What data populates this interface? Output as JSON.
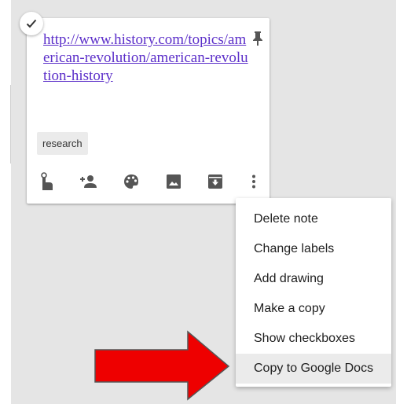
{
  "note": {
    "link_text": "http://www.history.com/topics/american-revolution/american-revolution-history",
    "label": "research",
    "icons": [
      "checkmark-icon",
      "pin-icon",
      "remind-icon",
      "collaborator-icon",
      "palette-icon",
      "image-icon",
      "archive-icon",
      "more-vert-icon"
    ]
  },
  "menu": {
    "items": [
      {
        "label": "Delete note"
      },
      {
        "label": "Change labels"
      },
      {
        "label": "Add drawing"
      },
      {
        "label": "Make a copy"
      },
      {
        "label": "Show checkboxes"
      },
      {
        "label": "Copy to Google Docs"
      }
    ],
    "highlighted": "Copy to Google Docs"
  },
  "colors": {
    "link": "#5b2ec9",
    "arrow_fill": "#ee0000",
    "background": "#e5e5e5",
    "highlight": "#ebebeb"
  }
}
